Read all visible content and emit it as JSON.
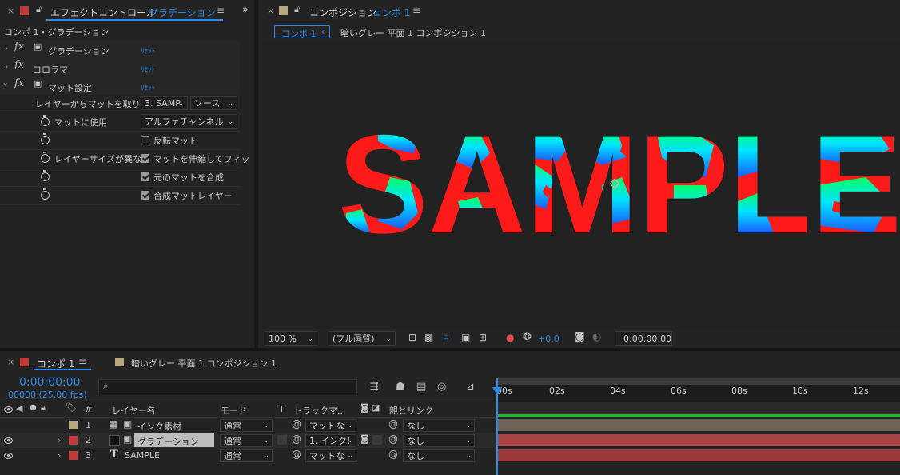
{
  "effect_controls": {
    "tab_title": "エフェクトコントロール",
    "tab_subject": "グラデーション",
    "breadcrumb": "コンポ 1・グラデーション",
    "effects": [
      {
        "name": "グラデーション",
        "reset": "ﾘｾｯﾄ"
      },
      {
        "name": "コロラマ",
        "reset": "ﾘｾｯﾄ"
      },
      {
        "name": "マット設定",
        "reset": "ﾘｾｯﾄ"
      }
    ],
    "properties": {
      "take_matte_label": "レイヤーからマットを取り込",
      "take_matte_layer": "3. SAMP",
      "take_matte_source": "ソース",
      "use_for_matte_label": "マットに使用",
      "use_for_matte_value": "アルファチャンネル",
      "invert_label": "反転マット",
      "invert_checked": false,
      "layer_size_label": "レイヤーサイズが異な",
      "stretch_label": "マットを伸縮してフィッ",
      "stretch_checked": true,
      "composite_label": "元のマットを合成",
      "composite_checked": true,
      "premultiply_label": "合成マットレイヤー",
      "premultiply_checked": true
    }
  },
  "composition": {
    "tab_title": "コンポジション",
    "tab_subject": "コンポ 1",
    "crumb_active": "コンポ 1",
    "crumb_next": "暗いグレー 平面 1 コンポジション 1",
    "sample_text": "SAMPLE",
    "colors": {
      "red": "#ff1a1a",
      "green": "#00ff66",
      "cyan": "#00e5ff",
      "blue": "#1a66ff",
      "bg": "#222222"
    }
  },
  "viewer_footer": {
    "zoom": "100 %",
    "resolution": "(フル画質)",
    "exposure": "+0.0",
    "timecode": "0:00:00:00"
  },
  "timeline": {
    "tab_active": "コンポ 1",
    "tab_other": "暗いグレー 平面 1 コンポジション 1",
    "timecode": "0:00:00:00",
    "frames": "00000 (25.00 fps)",
    "search_placeholder": "",
    "columns": {
      "number": "#",
      "layer_name": "レイヤー名",
      "mode": "モード",
      "t": "T",
      "track_matte": "トラックマ...",
      "parent": "親とリンク"
    },
    "ticks": [
      "00s",
      "02s",
      "04s",
      "06s",
      "08s",
      "10s",
      "12s"
    ],
    "layers": [
      {
        "num": "1",
        "name": "インク素材",
        "mode": "通常",
        "matte": "マットな",
        "parent": "なし",
        "color": "#b9a57d",
        "bar_color": "#6e6558"
      },
      {
        "num": "2",
        "name": "グラデーション",
        "mode": "通常",
        "matte": "1. インク!",
        "parent": "なし",
        "color": "#c03a3a",
        "bar_color": "#a84545"
      },
      {
        "num": "3",
        "name": "SAMPLE",
        "mode": "通常",
        "matte": "マットな",
        "parent": "なし",
        "color": "#c03a3a",
        "bar_color": "#9c3a3a"
      }
    ]
  }
}
